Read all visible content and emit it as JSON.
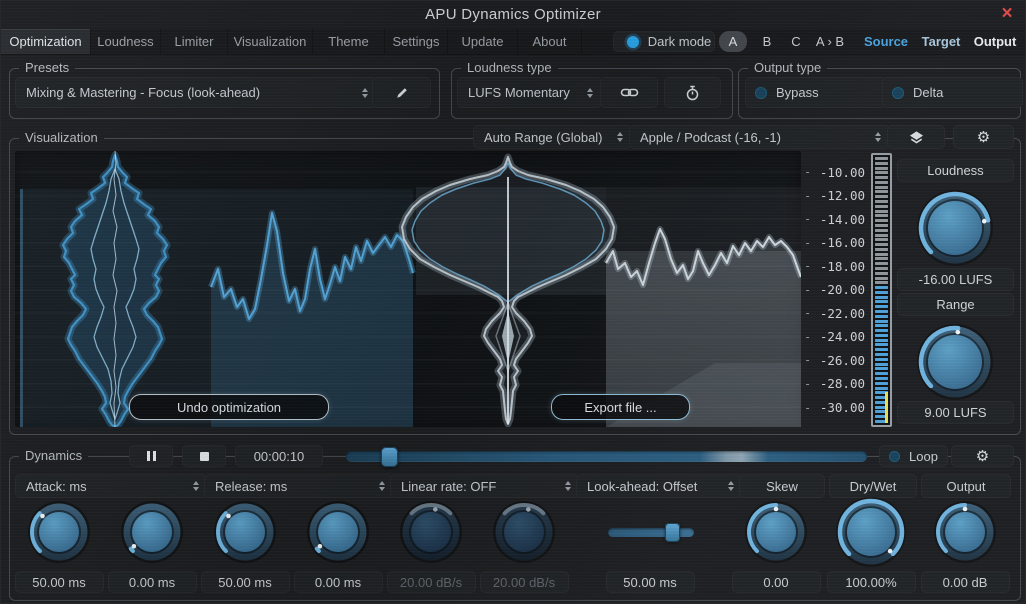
{
  "window": {
    "title": "APU Dynamics Optimizer",
    "close_glyph": "×"
  },
  "tabs": [
    {
      "label": "Optimization",
      "active": true
    },
    {
      "label": "Loudness",
      "active": false
    },
    {
      "label": "Limiter",
      "active": false
    },
    {
      "label": "Visualization",
      "active": false
    },
    {
      "label": "Theme",
      "active": false
    },
    {
      "label": "Settings",
      "active": false
    },
    {
      "label": "Update",
      "active": false
    },
    {
      "label": "About",
      "active": false
    }
  ],
  "header_controls": {
    "dark_mode_label": "Dark mode",
    "dark_mode_on": true,
    "ab_buttons": [
      {
        "label": "A",
        "selected": true
      },
      {
        "label": "B",
        "selected": false
      },
      {
        "label": "C",
        "selected": false
      }
    ],
    "ab_compare_label": "A › B",
    "view_buttons": [
      {
        "label": "Source",
        "color": "#4aa3e2",
        "bold": true
      },
      {
        "label": "Target",
        "color": "#a9c6da",
        "bold": true
      },
      {
        "label": "Output",
        "color": "#e8ebed",
        "bold": true
      }
    ]
  },
  "presets": {
    "group_label": "Presets",
    "selected": "Mixing & Mastering - Focus (look-ahead)"
  },
  "loudness_type": {
    "group_label": "Loudness type",
    "selected": "LUFS Momentary"
  },
  "output_type": {
    "group_label": "Output type",
    "toggles": [
      {
        "label": "Bypass",
        "on": false
      },
      {
        "label": "Delta",
        "on": false
      }
    ]
  },
  "visualization": {
    "group_label": "Visualization",
    "range_select": "Auto Range (Global)",
    "target_select": "Apple / Podcast (-16, -1)",
    "undo_button": "Undo optimization",
    "export_button": "Export file ...",
    "scale_ticks": [
      "-10.00",
      "-12.00",
      "-14.00",
      "-16.00",
      "-18.00",
      "-20.00",
      "-22.00",
      "-24.00",
      "-26.00",
      "-28.00",
      "-30.00"
    ],
    "meter": {
      "segments": 56,
      "gray_count": 27,
      "gray_color": "#8d949a",
      "blue_color": "#4da0d8",
      "peak_color": "#e6e24e"
    },
    "loudness": {
      "label": "Loudness",
      "value": "-16.00 LUFS",
      "arc_start": 0,
      "arc_end": 0.785,
      "dot": 0.785,
      "enabled": true
    },
    "range": {
      "label": "Range",
      "value": "9.00 LUFS",
      "arc_start": 0,
      "arc_end": 0.52,
      "dot": 0.52,
      "enabled": true
    }
  },
  "dynamics": {
    "group_label": "Dynamics",
    "transport": {
      "time": "00:00:10",
      "position_frac": 0.07,
      "loop_label": "Loop",
      "loop_on": false
    },
    "param_groups": [
      {
        "label": "Attack: ms",
        "dropdown": true
      },
      {
        "label": "Release: ms",
        "dropdown": true
      },
      {
        "label": "Linear rate: OFF",
        "dropdown": true
      },
      {
        "label": "Look-ahead: Offset",
        "dropdown": true
      },
      {
        "label": "Skew",
        "dropdown": false
      },
      {
        "label": "Dry/Wet",
        "dropdown": false
      },
      {
        "label": "Output",
        "dropdown": false
      }
    ],
    "controls": [
      {
        "name": "attack-knob-1",
        "type": "knob",
        "value": "50.00 ms",
        "arc_start": 0,
        "arc_end": 0.33,
        "dot": 0.33,
        "enabled": true
      },
      {
        "name": "attack-knob-2",
        "type": "knob",
        "value": "0.00 ms",
        "arc_start": 0,
        "arc_end": 0.025,
        "dot": 0.025,
        "enabled": true
      },
      {
        "name": "release-knob-1",
        "type": "knob",
        "value": "50.00 ms",
        "arc_start": 0,
        "arc_end": 0.33,
        "dot": 0.33,
        "enabled": true
      },
      {
        "name": "release-knob-2",
        "type": "knob",
        "value": "0.00 ms",
        "arc_start": 0,
        "arc_end": 0.025,
        "dot": 0.025,
        "enabled": true
      },
      {
        "name": "linear-rate-knob-1",
        "type": "knob",
        "value": "20.00 dB/s",
        "arc_start": 0.33,
        "arc_end": 0.67,
        "dot": 0.54,
        "enabled": false
      },
      {
        "name": "linear-rate-knob-2",
        "type": "knob",
        "value": "20.00 dB/s",
        "arc_start": 0.33,
        "arc_end": 0.67,
        "dot": 0.54,
        "enabled": false
      },
      {
        "name": "look-ahead-slider",
        "type": "slider",
        "value": "50.00 ms",
        "frac": 0.8,
        "enabled": true
      },
      {
        "name": "skew-knob",
        "type": "knob",
        "value": "0.00",
        "arc_start": 0,
        "arc_end": 0.5,
        "dot": 0.5,
        "enabled": true
      },
      {
        "name": "dry-wet-knob",
        "type": "knob",
        "value": "100.00%",
        "arc_start": 0,
        "arc_end": 1.0,
        "dot": 1.0,
        "enabled": true,
        "large": true
      },
      {
        "name": "output-knob",
        "type": "knob",
        "value": "0.00 dB",
        "arc_start": 0,
        "arc_end": 0.5,
        "dot": 0.5,
        "enabled": true
      }
    ]
  },
  "icons": {
    "close": "x",
    "edit": "pencil",
    "loudness_link": "chain-link",
    "loudness_response": "stopwatch",
    "layers": "layers",
    "settings": "gear",
    "pause": "pause",
    "stop": "stop",
    "dropdown": "up-down-arrows",
    "toggle": "circle-led"
  },
  "colors": {
    "accent": "#4da0d8",
    "knob_arc": "#72b9e6",
    "meter_peak": "#e6e24e"
  }
}
